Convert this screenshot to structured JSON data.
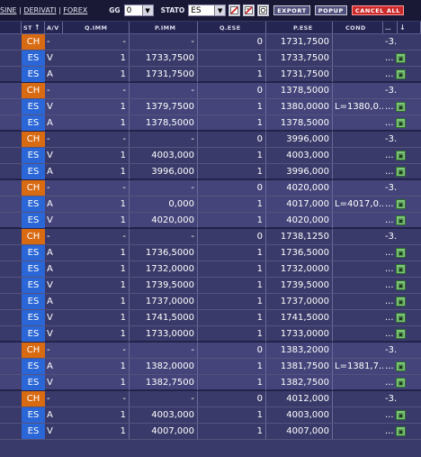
{
  "nav": {
    "item1": "SINE",
    "sep1": "|",
    "item2": "DERIVATI",
    "sep2": "|",
    "item3": "FOREX"
  },
  "filters": {
    "gg_label": "GG",
    "gg_value": "0",
    "stato_label": "STATO",
    "stato_value": "ES"
  },
  "buttons": {
    "export": "EXPORT",
    "popup": "POPUP",
    "cancel_all": "CANCEL ALL"
  },
  "columns": {
    "st": "ST",
    "st_arrow": "↑",
    "av": "A/V",
    "qimm": "Q.IMM",
    "pimm": "P.IMM",
    "qese": "Q.ESE",
    "pese": "P.ESE",
    "cond": "COND",
    "act": "…",
    "act_arrow": "↓"
  },
  "colors": {
    "ch": "#d86a12",
    "es": "#2a66d6",
    "group_a": "#3a3a6a",
    "group_b": "#44447a"
  },
  "rows": [
    {
      "st": "CH",
      "av": "-",
      "qimm": "-",
      "pimm": "-",
      "qese": "0",
      "pese": "1731,7500",
      "cond": "",
      "act": "-3...-",
      "btn": false,
      "g": 0
    },
    {
      "st": "ES",
      "av": "V",
      "qimm": "1",
      "pimm": "1733,7500",
      "qese": "1",
      "pese": "1733,7500",
      "cond": "",
      "act": "...",
      "btn": true,
      "g": 0
    },
    {
      "st": "ES",
      "av": "A",
      "qimm": "1",
      "pimm": "1731,7500",
      "qese": "1",
      "pese": "1731,7500",
      "cond": "",
      "act": "...",
      "btn": true,
      "g": 0,
      "last": true
    },
    {
      "st": "CH",
      "av": "-",
      "qimm": "-",
      "pimm": "-",
      "qese": "0",
      "pese": "1378,5000",
      "cond": "",
      "act": "-3...-",
      "btn": false,
      "g": 1
    },
    {
      "st": "ES",
      "av": "V",
      "qimm": "1",
      "pimm": "1379,7500",
      "qese": "1",
      "pese": "1380,0000",
      "cond": "L=1380,0...",
      "act": "...",
      "btn": true,
      "g": 1
    },
    {
      "st": "ES",
      "av": "A",
      "qimm": "1",
      "pimm": "1378,5000",
      "qese": "1",
      "pese": "1378,5000",
      "cond": "",
      "act": "...",
      "btn": true,
      "g": 1,
      "last": true
    },
    {
      "st": "CH",
      "av": "-",
      "qimm": "-",
      "pimm": "-",
      "qese": "0",
      "pese": "3996,000",
      "cond": "",
      "act": "-3...-",
      "btn": false,
      "g": 0
    },
    {
      "st": "ES",
      "av": "V",
      "qimm": "1",
      "pimm": "4003,000",
      "qese": "1",
      "pese": "4003,000",
      "cond": "",
      "act": "...",
      "btn": true,
      "g": 0
    },
    {
      "st": "ES",
      "av": "A",
      "qimm": "1",
      "pimm": "3996,000",
      "qese": "1",
      "pese": "3996,000",
      "cond": "",
      "act": "...",
      "btn": true,
      "g": 0,
      "last": true
    },
    {
      "st": "CH",
      "av": "-",
      "qimm": "-",
      "pimm": "-",
      "qese": "0",
      "pese": "4020,000",
      "cond": "",
      "act": "-3...-",
      "btn": false,
      "g": 1
    },
    {
      "st": "ES",
      "av": "A",
      "qimm": "1",
      "pimm": "0,000",
      "qese": "1",
      "pese": "4017,000",
      "cond": "L=4017,0...",
      "act": "...",
      "btn": true,
      "g": 1
    },
    {
      "st": "ES",
      "av": "V",
      "qimm": "1",
      "pimm": "4020,000",
      "qese": "1",
      "pese": "4020,000",
      "cond": "",
      "act": "...",
      "btn": true,
      "g": 1,
      "last": true
    },
    {
      "st": "CH",
      "av": "-",
      "qimm": "-",
      "pimm": "-",
      "qese": "0",
      "pese": "1738,1250",
      "cond": "",
      "act": "-3...-",
      "btn": false,
      "g": 0
    },
    {
      "st": "ES",
      "av": "A",
      "qimm": "1",
      "pimm": "1736,5000",
      "qese": "1",
      "pese": "1736,5000",
      "cond": "",
      "act": "...",
      "btn": true,
      "g": 0
    },
    {
      "st": "ES",
      "av": "A",
      "qimm": "1",
      "pimm": "1732,0000",
      "qese": "1",
      "pese": "1732,0000",
      "cond": "",
      "act": "...",
      "btn": true,
      "g": 0
    },
    {
      "st": "ES",
      "av": "V",
      "qimm": "1",
      "pimm": "1739,5000",
      "qese": "1",
      "pese": "1739,5000",
      "cond": "",
      "act": "...",
      "btn": true,
      "g": 0
    },
    {
      "st": "ES",
      "av": "A",
      "qimm": "1",
      "pimm": "1737,0000",
      "qese": "1",
      "pese": "1737,0000",
      "cond": "",
      "act": "...",
      "btn": true,
      "g": 0
    },
    {
      "st": "ES",
      "av": "V",
      "qimm": "1",
      "pimm": "1741,5000",
      "qese": "1",
      "pese": "1741,5000",
      "cond": "",
      "act": "...",
      "btn": true,
      "g": 0
    },
    {
      "st": "ES",
      "av": "V",
      "qimm": "1",
      "pimm": "1733,0000",
      "qese": "1",
      "pese": "1733,0000",
      "cond": "",
      "act": "...",
      "btn": true,
      "g": 0,
      "last": true
    },
    {
      "st": "CH",
      "av": "-",
      "qimm": "-",
      "pimm": "-",
      "qese": "0",
      "pese": "1383,2000",
      "cond": "",
      "act": "-3...-",
      "btn": false,
      "g": 1
    },
    {
      "st": "ES",
      "av": "A",
      "qimm": "1",
      "pimm": "1382,0000",
      "qese": "1",
      "pese": "1381,7500",
      "cond": "L=1381,7...",
      "act": "...",
      "btn": true,
      "g": 1
    },
    {
      "st": "ES",
      "av": "V",
      "qimm": "1",
      "pimm": "1382,7500",
      "qese": "1",
      "pese": "1382,7500",
      "cond": "",
      "act": "...",
      "btn": true,
      "g": 1,
      "last": true
    },
    {
      "st": "CH",
      "av": "-",
      "qimm": "-",
      "pimm": "-",
      "qese": "0",
      "pese": "4012,000",
      "cond": "",
      "act": "-3...-",
      "btn": false,
      "g": 0
    },
    {
      "st": "ES",
      "av": "A",
      "qimm": "1",
      "pimm": "4003,000",
      "qese": "1",
      "pese": "4003,000",
      "cond": "",
      "act": "...",
      "btn": true,
      "g": 0
    },
    {
      "st": "ES",
      "av": "V",
      "qimm": "1",
      "pimm": "4007,000",
      "qese": "1",
      "pese": "4007,000",
      "cond": "",
      "act": "...",
      "btn": true,
      "g": 0
    }
  ]
}
